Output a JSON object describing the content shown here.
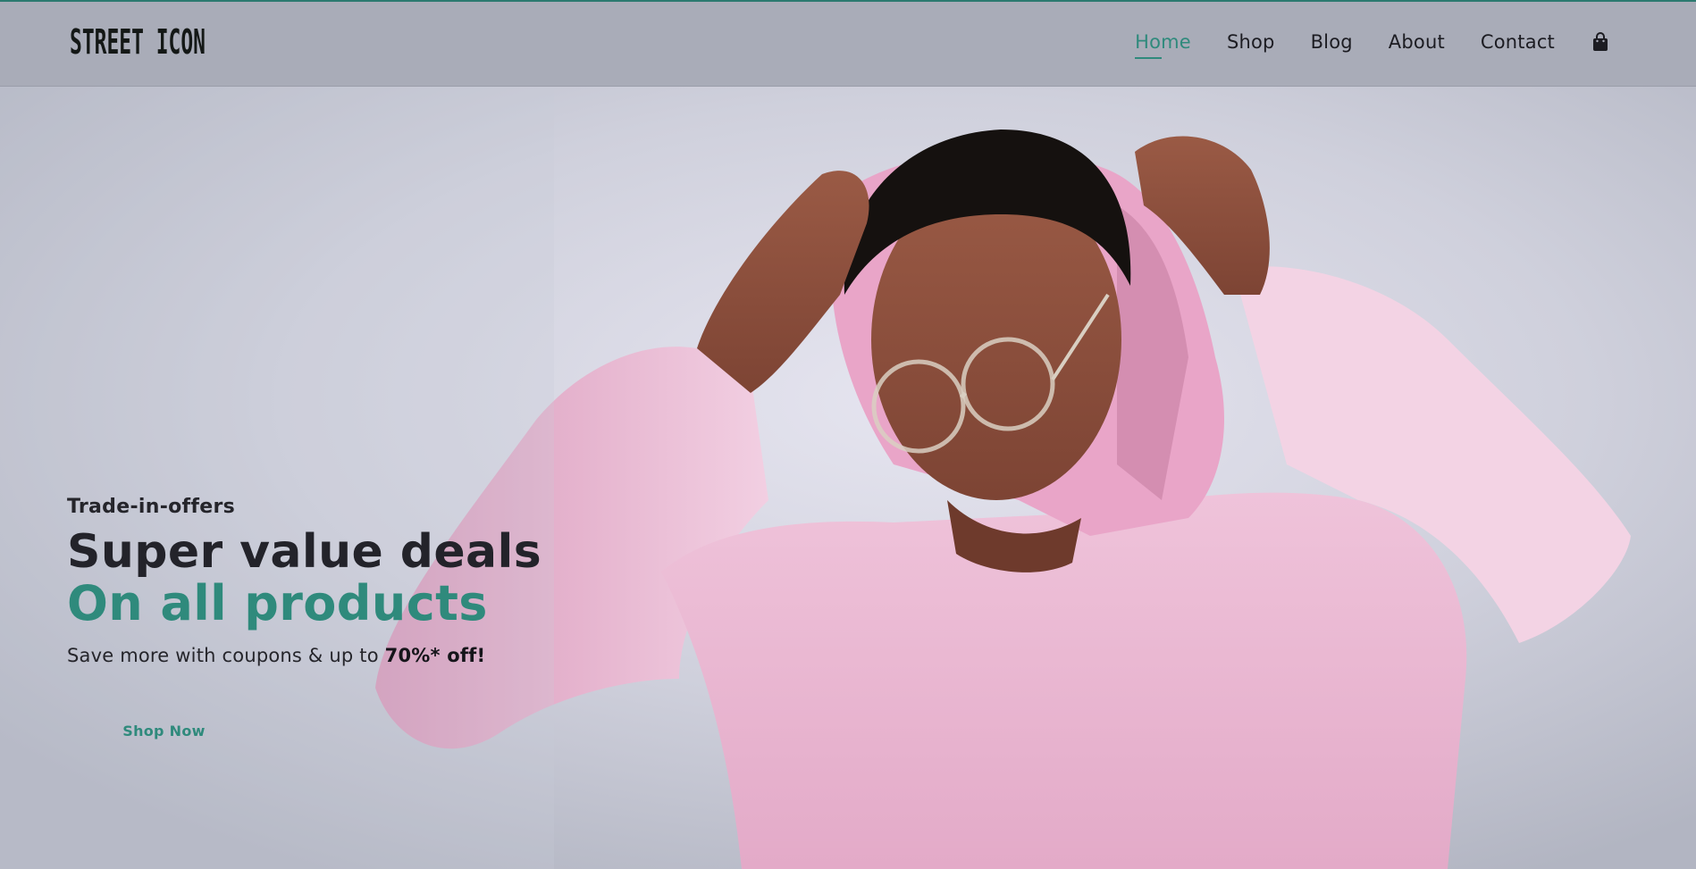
{
  "header": {
    "logo_text": "STREET ICON",
    "nav": [
      {
        "label": "Home",
        "active": true
      },
      {
        "label": "Shop",
        "active": false
      },
      {
        "label": "Blog",
        "active": false
      },
      {
        "label": "About",
        "active": false
      },
      {
        "label": "Contact",
        "active": false
      }
    ],
    "cart_icon": "shopping-bag-icon"
  },
  "hero": {
    "eyebrow": "Trade-in-offers",
    "headline": "Super value deals",
    "subheadline": "On all products",
    "promo_prefix": "Save more with coupons & up to ",
    "promo_highlight": "70%* off!",
    "button_label": "Shop Now",
    "image": "model-pink-hoodie-photo"
  },
  "colors": {
    "accent": "#2f8a7c",
    "header_bg": "#a9acb8",
    "text_dark": "#23232a",
    "hoodie_pink": "#eab8d2",
    "background": "#cfd0dc"
  }
}
